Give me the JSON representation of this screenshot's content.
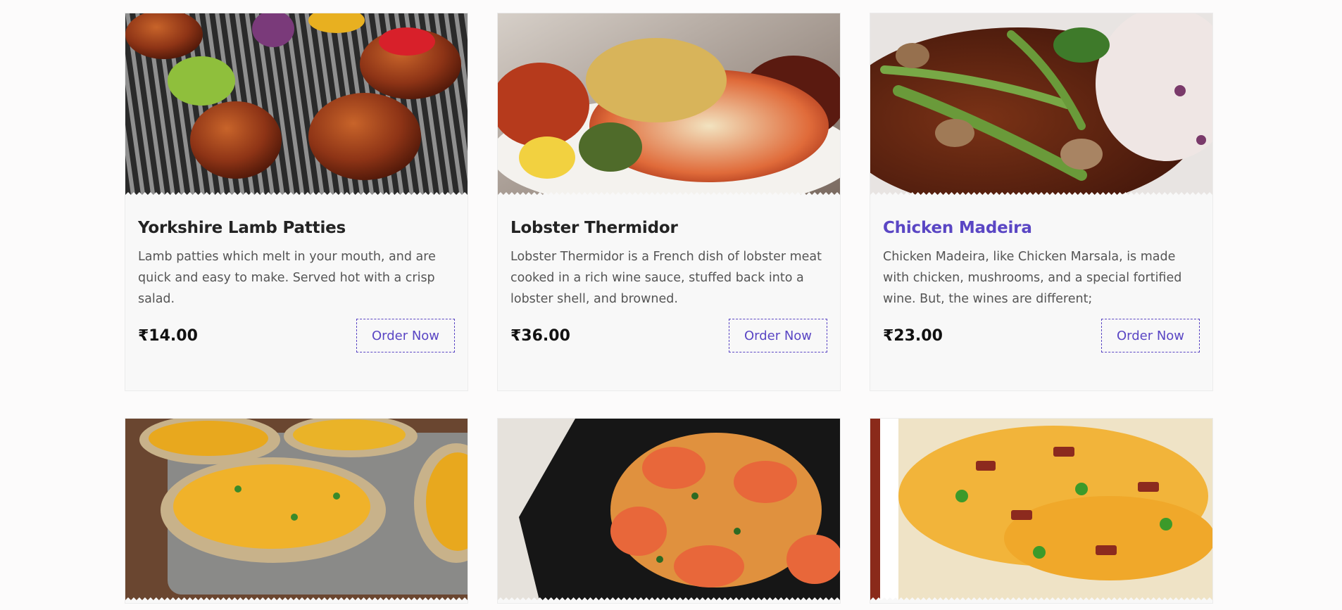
{
  "menu": {
    "items": [
      {
        "title": "Yorkshire Lamb Patties",
        "description": "Lamb patties which melt in your mouth, and are quick and easy to make. Served hot with a crisp salad.",
        "price": "₹14.00",
        "button_label": "Order Now",
        "image_icon": "lamb-patties-photo"
      },
      {
        "title": "Lobster Thermidor",
        "description": "Lobster Thermidor is a French dish of lobster meat cooked in a rich wine sauce, stuffed back into a lobster shell, and browned.",
        "price": "₹36.00",
        "button_label": "Order Now",
        "image_icon": "lobster-photo"
      },
      {
        "title": "Chicken Madeira",
        "description": "Chicken Madeira, like Chicken Marsala, is made with chicken, mushrooms, and a special fortified wine. But, the wines are different;",
        "price": "₹23.00",
        "button_label": "Order Now",
        "image_icon": "chicken-madeira-photo",
        "highlighted": true
      },
      {
        "image_icon": "stuffed-potatoes-photo"
      },
      {
        "image_icon": "shrimp-pasta-photo"
      },
      {
        "image_icon": "cheesy-casserole-photo"
      }
    ]
  },
  "colors": {
    "accent": "#5a46c4",
    "title": "#232323",
    "text": "#555555",
    "card_bg": "#f8f8f8",
    "page_bg": "#fcfbfb"
  }
}
